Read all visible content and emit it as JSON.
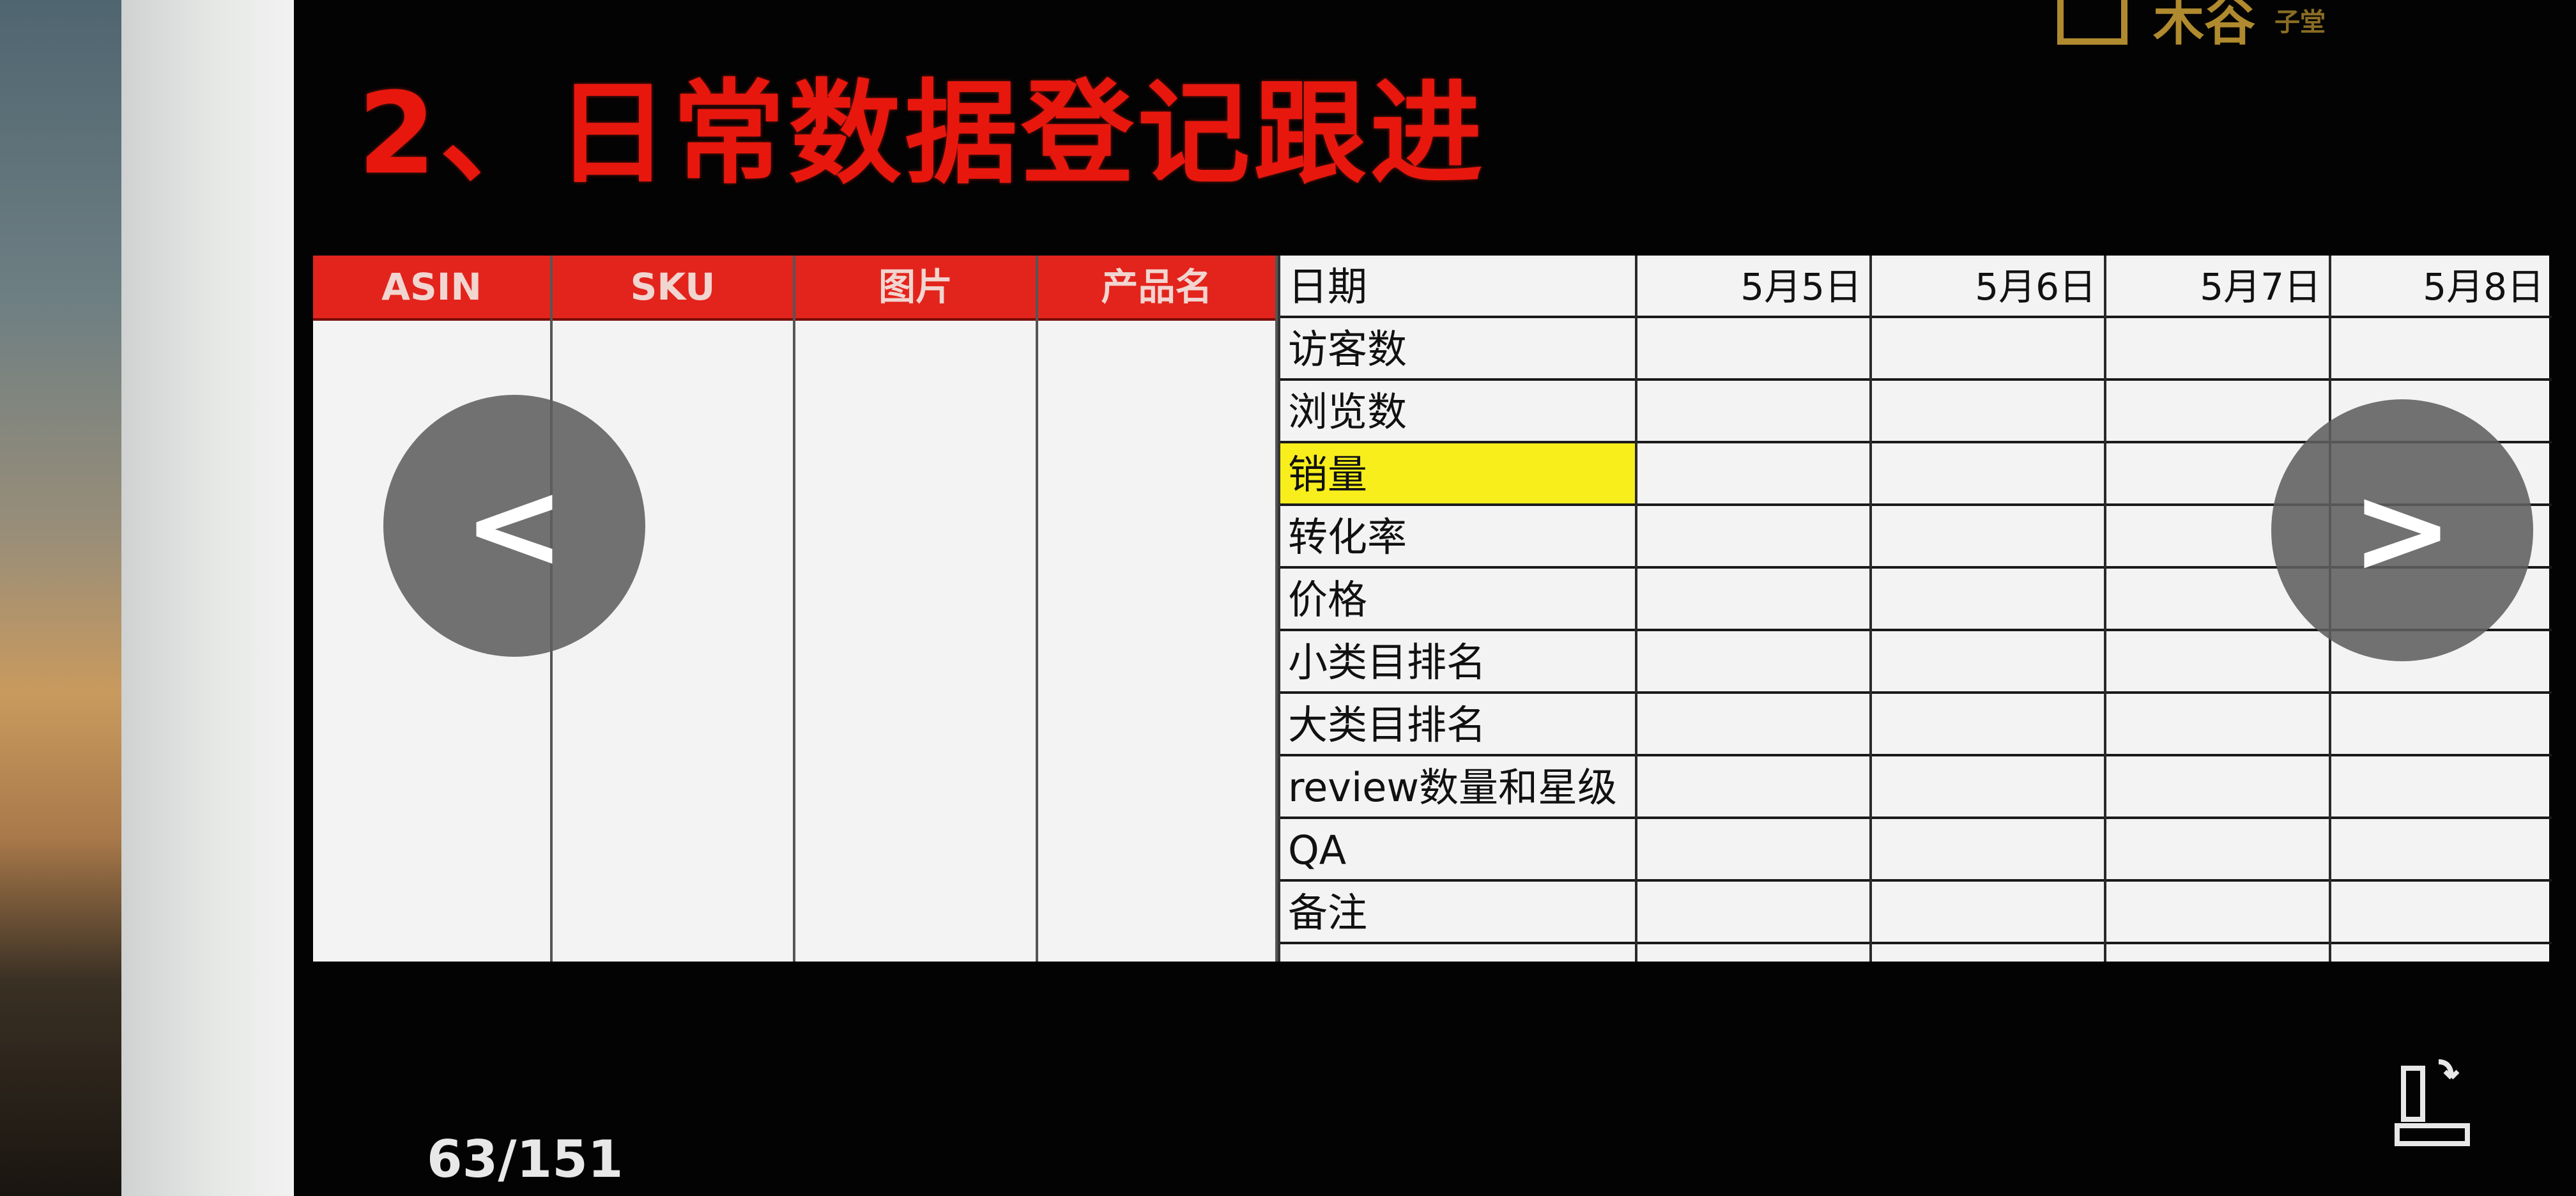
{
  "slide": {
    "title": "2、日常数据登记跟进",
    "logo_text": "木谷",
    "logo_sub": "子堂",
    "page_counter": "63/151"
  },
  "table": {
    "left_headers": [
      "ASIN",
      "SKU",
      "图片",
      "产品名"
    ],
    "date_header": "日期",
    "dates": [
      "5月5日",
      "5月6日",
      "5月7日",
      "5月8日"
    ],
    "rows": [
      {
        "label": "访客数",
        "highlight": false
      },
      {
        "label": "浏览数",
        "highlight": false
      },
      {
        "label": "销量",
        "highlight": true
      },
      {
        "label": "转化率",
        "highlight": false
      },
      {
        "label": "价格",
        "highlight": false
      },
      {
        "label": "小类目排名",
        "highlight": false
      },
      {
        "label": "大类目排名",
        "highlight": false
      },
      {
        "label": "review数量和星级",
        "highlight": false
      },
      {
        "label": "QA",
        "highlight": false
      },
      {
        "label": "备注",
        "highlight": false
      }
    ]
  },
  "navigation": {
    "prev_icon": "chevron-left-icon",
    "next_icon": "chevron-right-icon",
    "prev_glyph": "<",
    "next_glyph": ">"
  },
  "colors": {
    "title": "#e8170e",
    "header_bg": "#e3241c",
    "highlight": "#f7ee1c",
    "screen_bg": "#030303",
    "logo": "#b08a2e"
  }
}
